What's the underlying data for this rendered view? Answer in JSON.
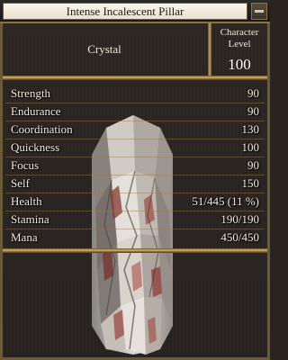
{
  "window": {
    "title": "Intense Incalescent Pillar"
  },
  "header": {
    "creature_name": "Crystal",
    "level_label": "Character\nLevel",
    "level_label_line1": "Character",
    "level_label_line2": "Level",
    "level_value": "100"
  },
  "stats": [
    {
      "label": "Strength",
      "value": "90"
    },
    {
      "label": "Endurance",
      "value": "90"
    },
    {
      "label": "Coordination",
      "value": "130"
    },
    {
      "label": "Quickness",
      "value": "100"
    },
    {
      "label": "Focus",
      "value": "90"
    },
    {
      "label": "Self",
      "value": "150"
    },
    {
      "label": "Health",
      "value": "51/445 (11 %)"
    },
    {
      "label": "Stamina",
      "value": "190/190"
    },
    {
      "label": "Mana",
      "value": "450/450"
    }
  ],
  "icons": {
    "close": "minimize-icon",
    "art": "crystal-pillar-image"
  },
  "colors": {
    "title_plate": "#f4efe3",
    "frame_gold": "#c4a66a",
    "background": "#2a2420",
    "text": "#efe6d6"
  }
}
